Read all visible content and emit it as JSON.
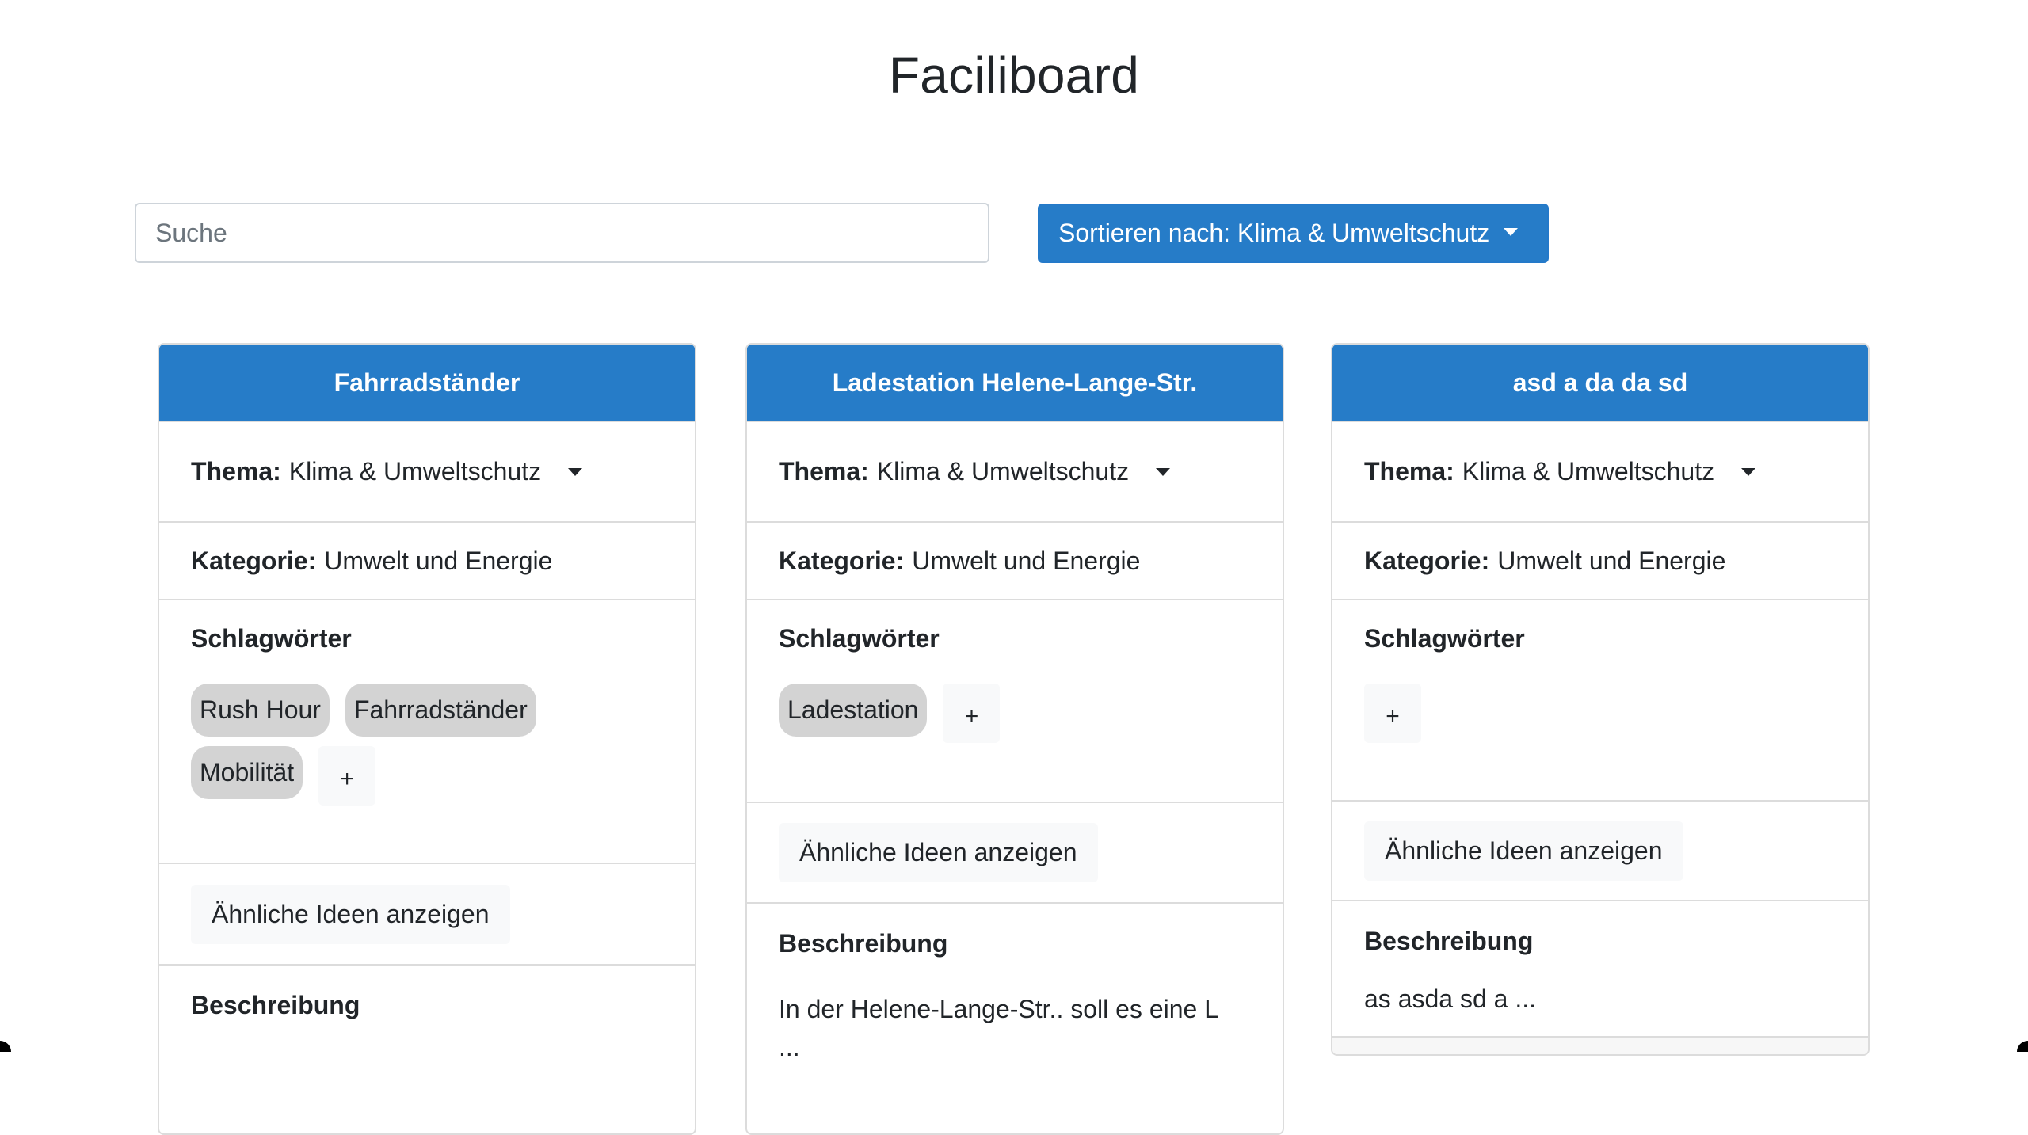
{
  "app": {
    "title": "Faciliboard"
  },
  "toolbar": {
    "search_placeholder": "Suche",
    "search_value": "",
    "sort_label": "Sortieren nach: Klima & Umweltschutz"
  },
  "labels": {
    "thema": "Thema:",
    "kategorie": "Kategorie:",
    "schlagwoerter": "Schlagwörter",
    "similar": "Ähnliche Ideen anzeigen",
    "beschreibung": "Beschreibung",
    "add_tag": "+"
  },
  "colors": {
    "primary": "#267cc8",
    "tag_bg": "#d3d3d3",
    "light_btn": "#f8f9fa"
  },
  "cards": [
    {
      "title": "Fahrradständer",
      "thema": "Klima & Umweltschutz",
      "kategorie": "Umwelt und Energie",
      "tags": [
        "Rush Hour",
        "Fahrradständer",
        "Mobilität"
      ],
      "description": ""
    },
    {
      "title": "Ladestation Helene-Lange-Str.",
      "thema": "Klima & Umweltschutz",
      "kategorie": "Umwelt und Energie",
      "tags": [
        "Ladestation"
      ],
      "description": "In der Helene-Lange-Str.. soll es eine L ..."
    },
    {
      "title": "asd a da da sd",
      "thema": "Klima & Umweltschutz",
      "kategorie": "Umwelt und Energie",
      "tags": [],
      "description": "as asda sd a ..."
    }
  ]
}
